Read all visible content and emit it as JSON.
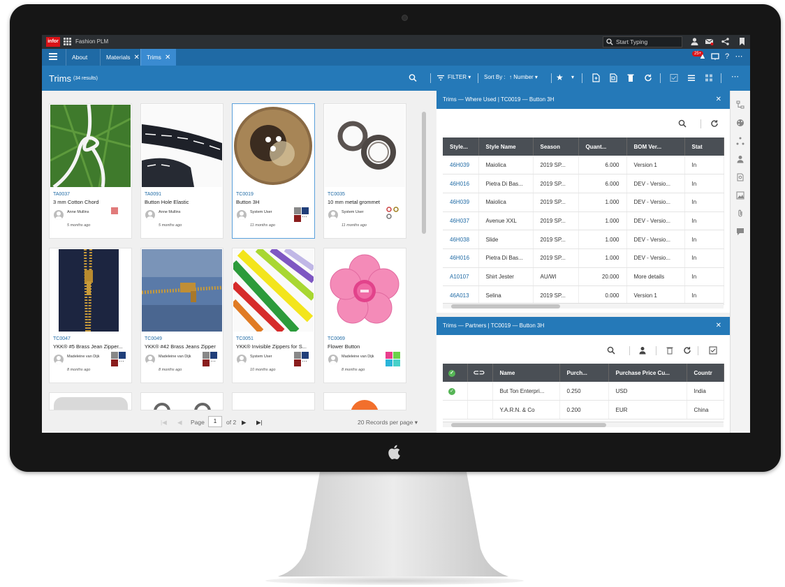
{
  "app": {
    "logo": "infor",
    "title": "Fashion PLM",
    "search_placeholder": "Start Typing",
    "notification_badge": "25+"
  },
  "tabs": [
    {
      "label": "About"
    },
    {
      "label": "Materials"
    },
    {
      "label": "Trims"
    }
  ],
  "header": {
    "title": "Trims",
    "count": "(34 results)",
    "filter_label": "FILTER",
    "sort_by_label": "Sort By :",
    "sort_field": "Number"
  },
  "cards": [
    {
      "code": "TA0037",
      "name": "3 mm Cotton Chord",
      "user": "Anne Mullins",
      "ago": "5 months ago"
    },
    {
      "code": "TA0091",
      "name": "Button Hole Elastic",
      "user": "Anne Mullins",
      "ago": "5 months ago"
    },
    {
      "code": "TC0019",
      "name": "Button 3H",
      "user": "System User",
      "ago": "11 months ago"
    },
    {
      "code": "TC0035",
      "name": "10 mm metal grommet",
      "user": "System User",
      "ago": "11 months ago"
    },
    {
      "code": "TC0047",
      "name": "YKK® #5 Brass Jean Zipper...",
      "user": "Madeleine van Dijk",
      "ago": "8 months ago"
    },
    {
      "code": "TC0049",
      "name": "YKK® #42 Brass Jeans Zipper",
      "user": "Madeleine van Dijk",
      "ago": "8 months ago"
    },
    {
      "code": "TC0051",
      "name": "YKK® Invisible Zippers for S...",
      "user": "System User",
      "ago": "10 months ago"
    },
    {
      "code": "TC0069",
      "name": "Flower Button",
      "user": "Madeleine van Dijk",
      "ago": "8 months ago"
    }
  ],
  "pager": {
    "page_label": "Page",
    "page_value": "1",
    "of_label": "of 2",
    "records": "20 Records per page"
  },
  "where_used": {
    "title": "Trims — Where Used | TC0019 — Button 3H",
    "columns": [
      "Style...",
      "Style Name",
      "Season",
      "Quant...",
      "BOM Ver...",
      "Stat"
    ],
    "rows": [
      [
        "46H039",
        "Maiolica",
        "2019 SP...",
        "6.000",
        "Version 1",
        "In"
      ],
      [
        "46H016",
        "Pietra Di Bas...",
        "2019 SP...",
        "6.000",
        "DEV - Versio...",
        "In"
      ],
      [
        "46H039",
        "Maiolica",
        "2019 SP...",
        "1.000",
        "DEV - Versio...",
        "In"
      ],
      [
        "46H037",
        "Avenue XXL",
        "2019 SP...",
        "1.000",
        "DEV - Versio...",
        "In"
      ],
      [
        "46H038",
        "Slide",
        "2019 SP...",
        "1.000",
        "DEV - Versio...",
        "In"
      ],
      [
        "46H016",
        "Pietra Di Bas...",
        "2019 SP...",
        "1.000",
        "DEV - Versio...",
        "In"
      ],
      [
        "A10107",
        "Shirt Jester",
        "AU/WI",
        "20.000",
        "More details",
        "In"
      ],
      [
        "46A013",
        "Selina",
        "2019 SP...",
        "0.000",
        "Version 1",
        "In"
      ]
    ]
  },
  "partners": {
    "title": "Trims — Partners | TC0019 — Button 3H",
    "columns": [
      "",
      "",
      "Name",
      "Purch...",
      "Purchase Price Cu...",
      "Countr"
    ],
    "rows": [
      [
        "",
        "",
        "But Ton Enterpri...",
        "0.250",
        "USD",
        "India"
      ],
      [
        "",
        "",
        "Y.A.R.N. & Co",
        "0.200",
        "EUR",
        "China"
      ]
    ]
  }
}
